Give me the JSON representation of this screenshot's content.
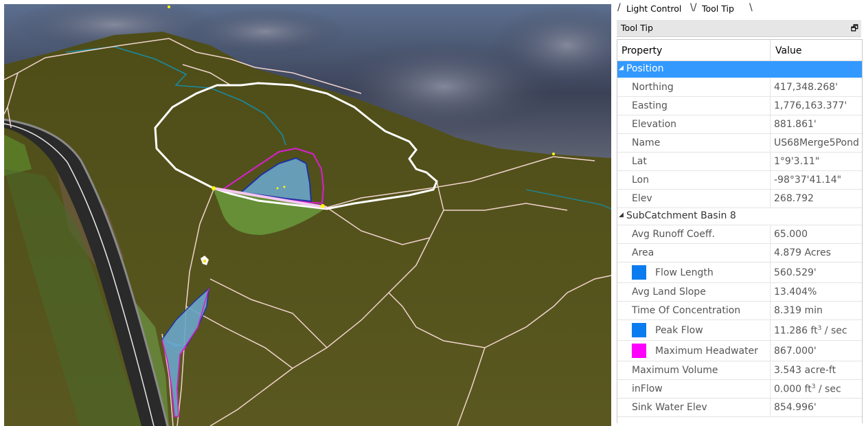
{
  "tabs": [
    {
      "label": "Light Control"
    },
    {
      "label": "Tool Tip"
    }
  ],
  "panel_title": "Tool Tip",
  "pin_icon": "restore-window-icon",
  "columns": {
    "property": "Property",
    "value": "Value"
  },
  "groups": [
    {
      "label": "Position",
      "selected": true,
      "rows": [
        {
          "name": "Northing",
          "value": "417,348.268'"
        },
        {
          "name": "Easting",
          "value": "1,776,163.377'"
        },
        {
          "name": "Elevation",
          "value": "881.861'"
        },
        {
          "name": "Name",
          "value": "US68Merge5Pond"
        },
        {
          "name": "Lat",
          "value": "1°9'3.11\""
        },
        {
          "name": "Lon",
          "value": "-98°37'41.14\""
        },
        {
          "name": "Elev",
          "value": "268.792"
        }
      ]
    },
    {
      "label": "SubCatchment Basin 8",
      "selected": false,
      "rows": [
        {
          "name": "Avg Runoff Coeff.",
          "value": "65.000"
        },
        {
          "name": "Area",
          "value": "4.879 Acres"
        },
        {
          "name": "Flow Length",
          "value": "560.529'",
          "swatch": "#0a7cf0"
        },
        {
          "name": "Avg Land Slope",
          "value": "13.404%"
        },
        {
          "name": "Time Of Concentration",
          "value": "8.319 min"
        },
        {
          "name": "Peak Flow",
          "value_pre": "11.286 ft",
          "value_sup": "3",
          "value_post": " / sec",
          "swatch": "#0a7cf0"
        },
        {
          "name": "Maximum Headwater",
          "value": "867.000'",
          "swatch": "#ff00ff"
        },
        {
          "name": "Maximum Volume",
          "value": "3.543 acre-ft"
        },
        {
          "name": "inFlow",
          "value_pre": "0.000 ft",
          "value_sup": "3",
          "value_post": " / sec"
        },
        {
          "name": "Sink Water Elev",
          "value": "854.996'"
        }
      ]
    }
  ],
  "colors": {
    "selection": "#3399ff",
    "terrain": "#55521a",
    "sky": "#3a4258",
    "pond": "#6aa6c8",
    "road": "#2a2a2a",
    "boundary_white": "#ffffff",
    "boundary_pink": "#f0d0cc",
    "headwater": "#d81fd0",
    "stream": "#1a8aa0"
  }
}
